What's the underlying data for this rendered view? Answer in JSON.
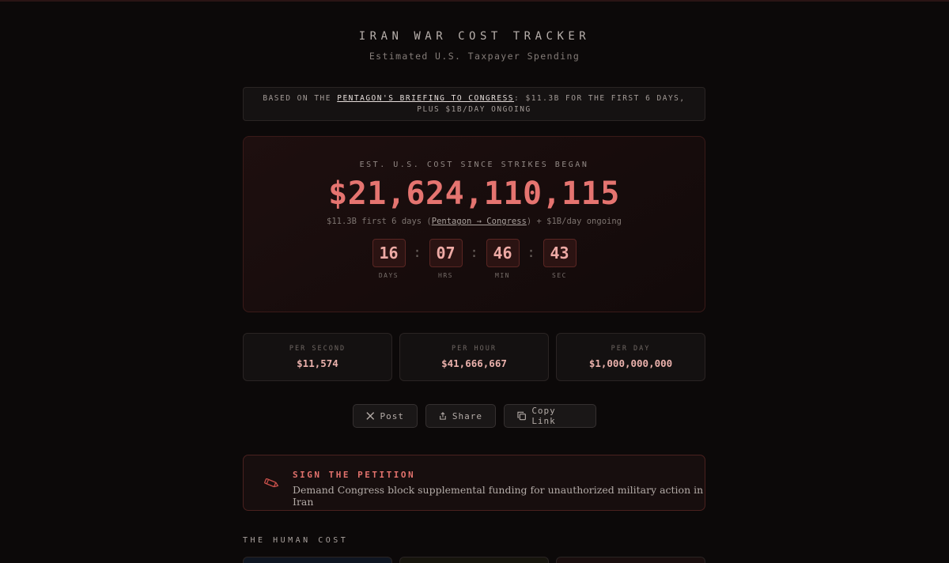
{
  "header": {
    "title": "IRAN WAR COST TRACKER",
    "subtitle": "Estimated U.S. Taxpayer Spending"
  },
  "notice": {
    "prefix": "BASED ON THE ",
    "link": "PENTAGON'S BRIEFING TO CONGRESS",
    "suffix": ": $11.3B FOR THE FIRST 6 DAYS, PLUS $1B/DAY ONGOING"
  },
  "hero": {
    "label": "EST. U.S. COST SINCE STRIKES BEGAN",
    "amount": "$21,624,110,115",
    "detail_prefix": "$11.3B first 6 days (",
    "detail_link": "Pentagon → Congress",
    "detail_suffix": ") + $1B/day ongoing"
  },
  "countdown": [
    {
      "value": "16",
      "label": "DAYS"
    },
    {
      "value": "07",
      "label": "HRS"
    },
    {
      "value": "46",
      "label": "MIN"
    },
    {
      "value": "43",
      "label": "SEC"
    }
  ],
  "separator": ":",
  "stats": [
    {
      "label": "PER SECOND",
      "value": "$11,574"
    },
    {
      "label": "PER HOUR",
      "value": "$41,666,667"
    },
    {
      "label": "PER DAY",
      "value": "$1,000,000,000"
    }
  ],
  "share": {
    "post": "Post",
    "share": "Share",
    "copy": "Copy Link",
    "post_icon": "x-logo-icon",
    "share_icon": "share-icon",
    "copy_icon": "copy-icon"
  },
  "petition": {
    "title": "SIGN THE PETITION",
    "description": "Demand Congress block supplemental funding for unauthorized military action in Iran",
    "icon": "pencil-icon"
  },
  "section": {
    "human_cost": "THE HUMAN COST"
  },
  "colors": {
    "background": "#0c0909",
    "accent": "#e57470",
    "digit": "#eeaaa5"
  }
}
